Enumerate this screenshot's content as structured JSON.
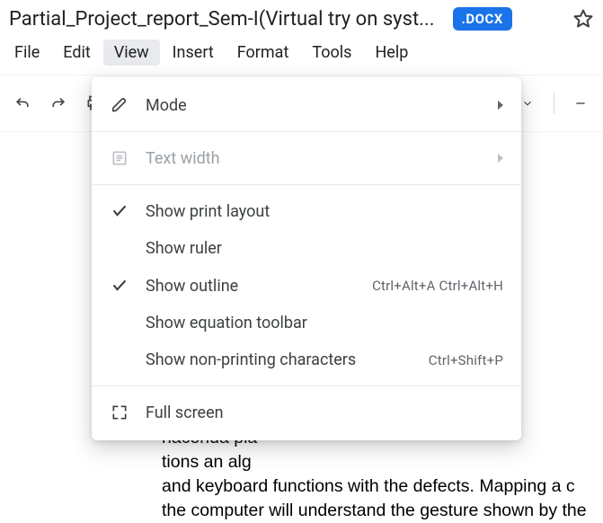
{
  "titlebar": {
    "doc_title": "Partial_Project_report_Sem-I(Virtual try on syst...",
    "badge": ".DOCX"
  },
  "menubar": {
    "file": "File",
    "edit": "Edit",
    "view": "View",
    "insert": "Insert",
    "format": "Format",
    "tools": "Tools",
    "help": "Help"
  },
  "dropdown": {
    "mode": "Mode",
    "text_width": "Text width",
    "show_print_layout": "Show print layout",
    "show_ruler": "Show ruler",
    "show_outline": "Show outline",
    "show_outline_shortcut": "Ctrl+Alt+A Ctrl+Alt+H",
    "show_equation_toolbar": "Show equation toolbar",
    "show_non_printing": "Show non-printing characters",
    "show_non_printing_shortcut": "Ctrl+Shift+P",
    "full_screen": "Full screen"
  },
  "document": {
    "body_text": "Mouse and\nlogy, Chennai\nhas reached\nocessing. In\ne, like Face\nd in creating\nll read the\nment of the\nand left c\nne different\nswipe left\n. The only l\nnaconda pla\ntions an alg\nand keyboard functions with the defects. Mapping a c\nthe computer will understand the gesture shown by the"
  }
}
